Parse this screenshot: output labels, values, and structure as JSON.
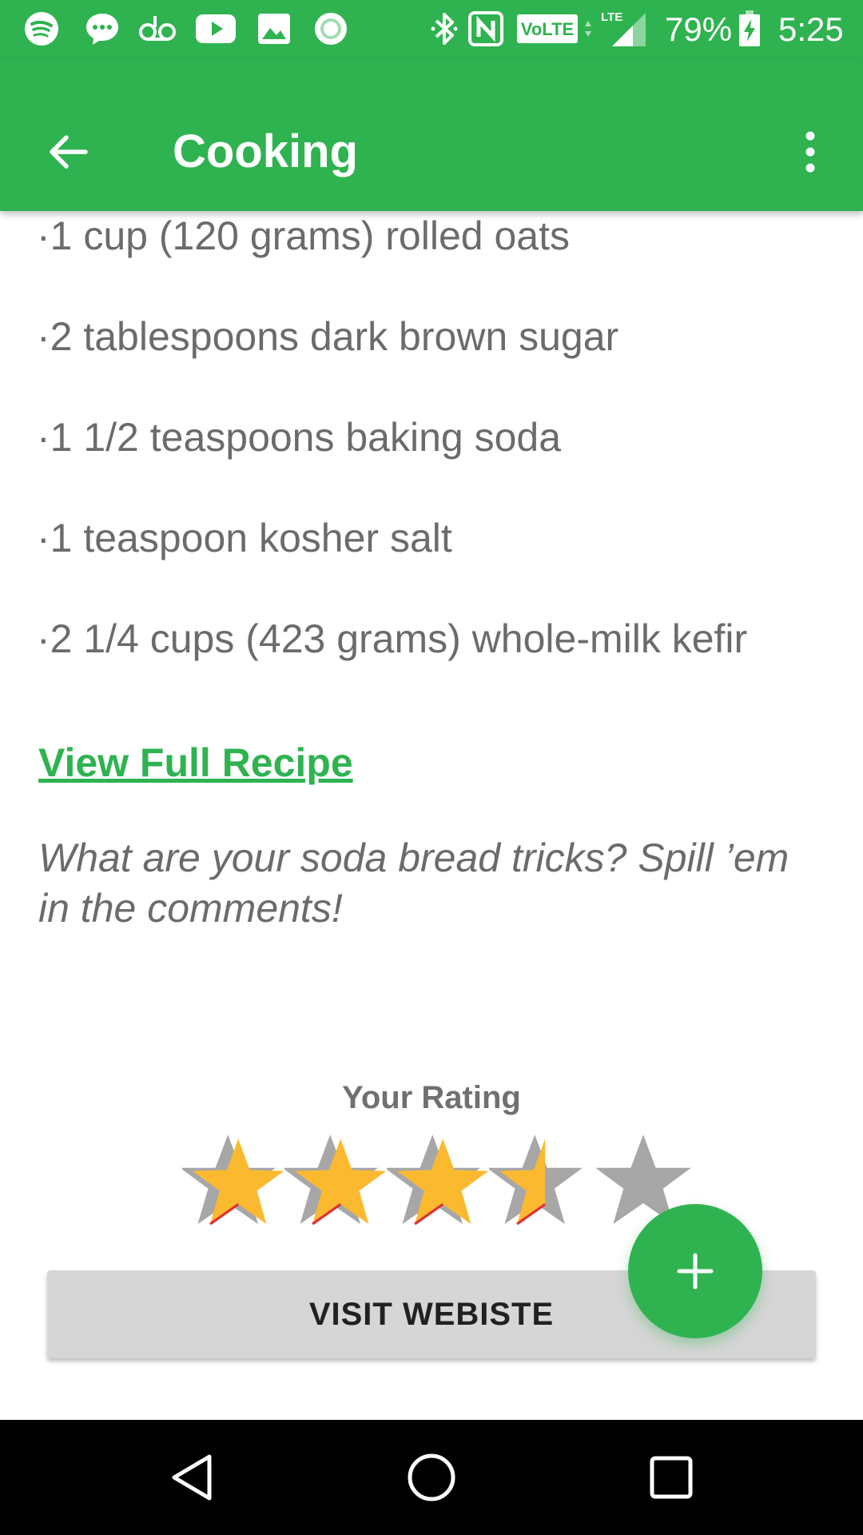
{
  "status_bar": {
    "battery": "79%",
    "time": "5:25",
    "network": "LTE",
    "volte": "VoLTE",
    "icons": [
      "spotify-icon",
      "messenger-icon",
      "voicemail-icon",
      "youtube-icon",
      "gallery-icon",
      "record-icon",
      "bluetooth-icon",
      "nfc-icon",
      "volte-icon",
      "signal-icon",
      "battery-charging-icon"
    ]
  },
  "app_bar": {
    "title": "Cooking",
    "back_icon": "arrow-back-icon",
    "menu_icon": "more-vert-icon"
  },
  "recipe": {
    "ingredients": [
      "·1 cup (120 grams) rolled oats",
      "·2 tablespoons dark brown sugar",
      "·1 1/2 teaspoons baking soda",
      "·1 teaspoon kosher salt",
      "·2 1/4 cups (423 grams) whole-milk kefir"
    ],
    "view_full_recipe": "View Full Recipe",
    "prompt": "What are your soda bread tricks? Spill ’em in the comments!"
  },
  "rating": {
    "label": "Your Rating",
    "value": 3.5,
    "max": 5
  },
  "visit_button": "VISIT WEBISTE",
  "fab_icon": "plus-icon",
  "colors": {
    "primary": "#2fb350",
    "star_filled": "#fbb930",
    "star_empty": "#a7a7a7",
    "text_secondary": "#6b6b6b"
  },
  "nav_bar": {
    "icons": [
      "back-triangle-icon",
      "home-circle-icon",
      "recents-square-icon"
    ]
  }
}
